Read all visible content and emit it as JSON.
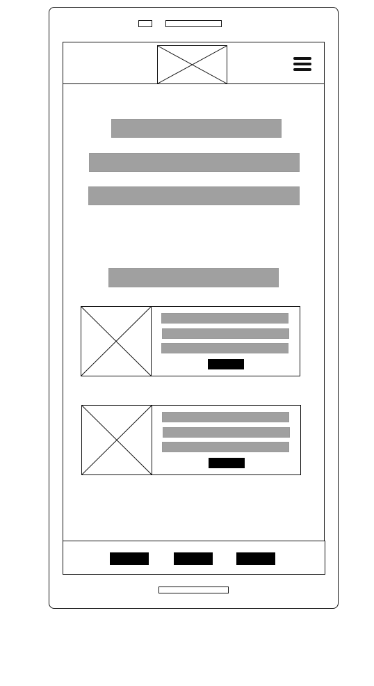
{
  "colors": {
    "outline": "#111111",
    "placeholder_text": "#a0a0a0",
    "button": "#000000",
    "background": "#ffffff"
  },
  "header": {
    "logo": "image-placeholder",
    "menu_icon": "hamburger-icon"
  },
  "hero": {
    "text_lines": 3
  },
  "section": {
    "heading": "text-placeholder"
  },
  "cards": [
    {
      "image": "image-placeholder",
      "text_lines": 3,
      "button": "button-placeholder"
    },
    {
      "image": "image-placeholder",
      "text_lines": 3,
      "button": "button-placeholder"
    }
  ],
  "bottom_nav": {
    "buttons": 3
  }
}
